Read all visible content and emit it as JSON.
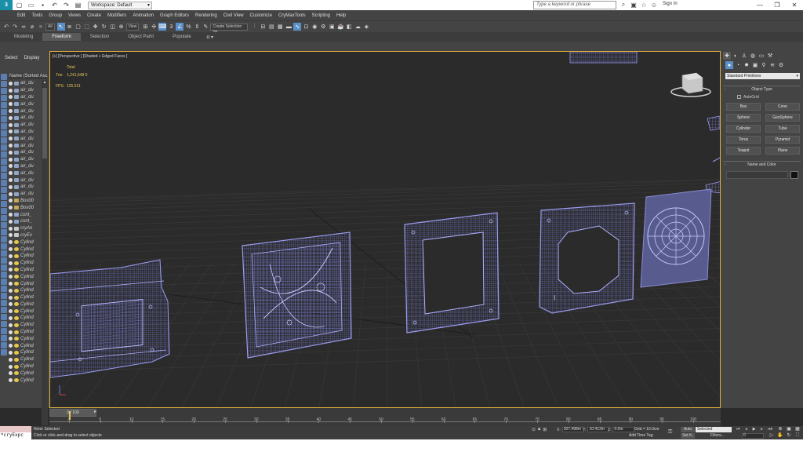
{
  "title_bar": {
    "app_icon": "3ds-max-logo",
    "workspace_label": "Workspace: Default",
    "search_placeholder": "Type a keyword or phrase",
    "sign_in": "Sign In",
    "window_controls": [
      "minimize",
      "maximize",
      "close"
    ]
  },
  "menu": [
    "Edit",
    "Tools",
    "Group",
    "Views",
    "Create",
    "Modifiers",
    "Animation",
    "Graph Editors",
    "Rendering",
    "Civil View",
    "Customize",
    "CryMaxTools",
    "Scripting",
    "Help"
  ],
  "toolbar": {
    "selection_filter": "All",
    "view_drop": "View",
    "named_selection": "Create Selection Se"
  },
  "ribbon": {
    "tabs": [
      "Modeling",
      "Freeform",
      "Selection",
      "Object Paint",
      "Populate"
    ],
    "active_tab": "Freeform"
  },
  "scene_explorer": {
    "tabs": [
      "Select",
      "Display"
    ],
    "column_header": "Name (Sorted Asc",
    "items": [
      {
        "label": "air_du",
        "type": "mesh"
      },
      {
        "label": "air_du",
        "type": "mesh"
      },
      {
        "label": "air_du",
        "type": "mesh"
      },
      {
        "label": "air_du",
        "type": "mesh"
      },
      {
        "label": "air_du",
        "type": "mesh"
      },
      {
        "label": "air_du",
        "type": "mesh"
      },
      {
        "label": "air_du",
        "type": "mesh"
      },
      {
        "label": "air_du",
        "type": "mesh"
      },
      {
        "label": "air_du",
        "type": "mesh"
      },
      {
        "label": "air_du",
        "type": "mesh"
      },
      {
        "label": "air_du",
        "type": "mesh"
      },
      {
        "label": "air_du",
        "type": "mesh"
      },
      {
        "label": "air_du",
        "type": "mesh"
      },
      {
        "label": "air_du",
        "type": "mesh"
      },
      {
        "label": "air_du",
        "type": "mesh"
      },
      {
        "label": "air_du",
        "type": "mesh"
      },
      {
        "label": "air_du",
        "type": "mesh"
      },
      {
        "label": "Box00",
        "type": "box"
      },
      {
        "label": "Box00",
        "type": "box"
      },
      {
        "label": "cont_",
        "type": "mesh"
      },
      {
        "label": "cont_",
        "type": "mesh"
      },
      {
        "label": "cryAn",
        "type": "helper"
      },
      {
        "label": "cryEx",
        "type": "helper"
      },
      {
        "label": "Cylind",
        "type": "cylinder"
      },
      {
        "label": "Cylind",
        "type": "cylinder"
      },
      {
        "label": "Cylind",
        "type": "cylinder"
      },
      {
        "label": "Cylind",
        "type": "cylinder"
      },
      {
        "label": "Cylind",
        "type": "cylinder"
      },
      {
        "label": "Cylind",
        "type": "cylinder"
      },
      {
        "label": "Cylind",
        "type": "cylinder"
      },
      {
        "label": "Cylind",
        "type": "cylinder"
      },
      {
        "label": "Cylind",
        "type": "cylinder"
      },
      {
        "label": "Cylind",
        "type": "cylinder"
      },
      {
        "label": "Cylind",
        "type": "cylinder"
      },
      {
        "label": "Cylind",
        "type": "cylinder"
      },
      {
        "label": "Cylind",
        "type": "cylinder"
      },
      {
        "label": "Cylind",
        "type": "cylinder"
      },
      {
        "label": "Cylind",
        "type": "cylinder"
      },
      {
        "label": "Cylind",
        "type": "cylinder"
      },
      {
        "label": "Cylind",
        "type": "cylinder"
      },
      {
        "label": "Cylind",
        "type": "cylinder"
      },
      {
        "label": "Cylind",
        "type": "cylinder"
      },
      {
        "label": "Cylind",
        "type": "cylinder"
      },
      {
        "label": "Cylind",
        "type": "cylinder"
      }
    ]
  },
  "viewport": {
    "label": "[+] [Perspective ] [Shaded + Edged Faces ]",
    "stats": {
      "total_label": "Total",
      "tris_label": "Tris:",
      "tris_value": "1,241,648 0",
      "fps_label": "FPS:",
      "fps_value": "125.511"
    },
    "border_color": "#e0b13b",
    "wire_color": "#9a9cf0"
  },
  "command_panel": {
    "category": "Standard Primitives",
    "object_type_title": "Object Type",
    "autogrid_label": "AutoGrid",
    "primitives": [
      "Box",
      "Cone",
      "Sphere",
      "GeoSphere",
      "Cylinder",
      "Tube",
      "Torus",
      "Pyramid",
      "Teapot",
      "Plane"
    ],
    "name_color_title": "Name and Color"
  },
  "timeline": {
    "slider_label": "0 / 100",
    "ticks": [
      0,
      5,
      10,
      15,
      20,
      25,
      30,
      35,
      40,
      45,
      50,
      55,
      60,
      65,
      70,
      75,
      80,
      85,
      90,
      95,
      100
    ],
    "current_frame_fraction": 0
  },
  "status": {
    "script_text": "*cryExpc",
    "selection_status": "None Selected",
    "prompt": "Click or click-and-drag to select objects",
    "x_label": "X:",
    "x_value": "307.498m",
    "y_label": "Y:",
    "y_value": "10.413m",
    "z_label": "Z:",
    "z_value": "0.0m",
    "grid": "Grid = 10.0cm",
    "add_time_tag": "Add Time Tag",
    "auto_key": "Auto",
    "set_key": "Set K.",
    "key_filter": "Selected",
    "filters": "Filters...",
    "frame": "0"
  }
}
